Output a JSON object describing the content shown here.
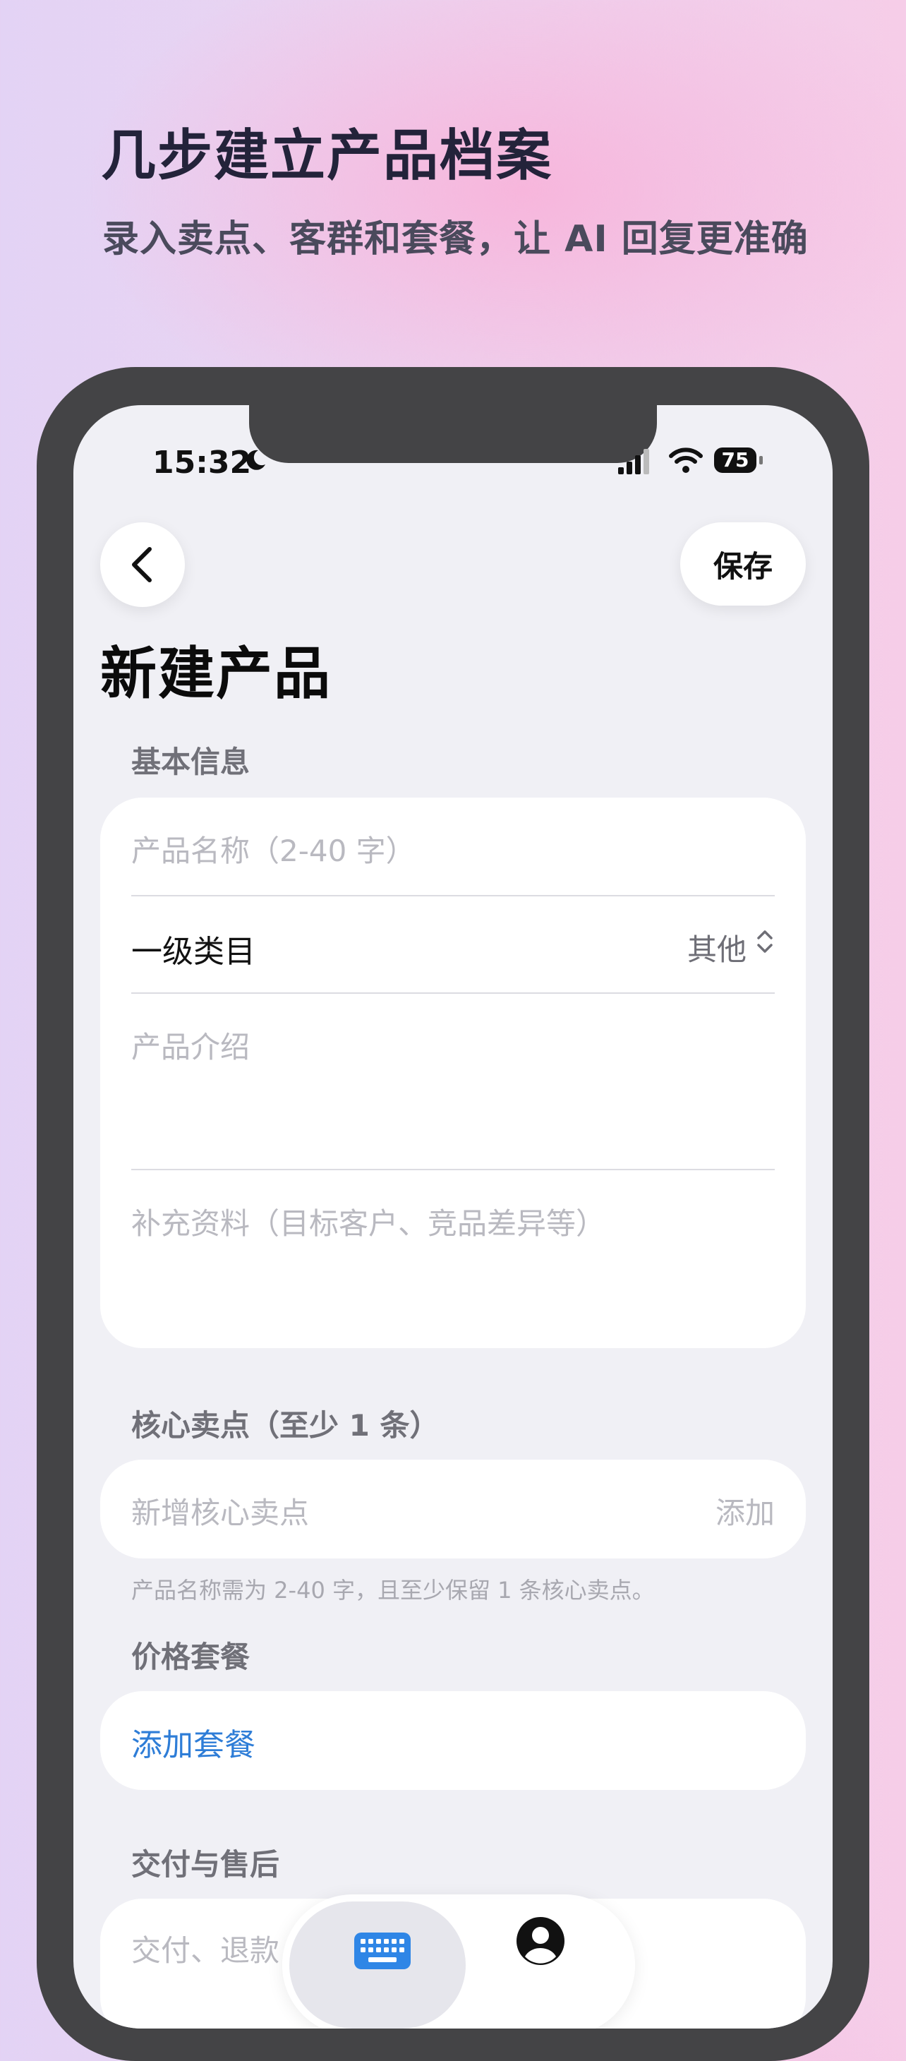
{
  "hero": {
    "title": "几步建立产品档案",
    "subtitle": "录入卖点、客群和套餐，让 AI 回复更准确"
  },
  "status_bar": {
    "time": "15:32",
    "battery": "75",
    "icons": [
      "moon-icon",
      "signal-icon",
      "wifi-icon",
      "battery-icon"
    ]
  },
  "nav": {
    "back_icon": "chevron-left-icon",
    "save_label": "保存"
  },
  "page_title": "新建产品",
  "basic_info": {
    "section_label": "基本信息",
    "name_placeholder": "产品名称（2-40 字）",
    "category_label": "一级类目",
    "category_value": "其他",
    "intro_placeholder": "产品介绍",
    "extra_placeholder": "补充资料（目标客户、竞品差异等）"
  },
  "selling_points": {
    "section_label": "核心卖点（至少 1 条）",
    "input_placeholder": "新增核心卖点",
    "add_label": "添加",
    "hint": "产品名称需为 2-40 字，且至少保留 1 条核心卖点。"
  },
  "pricing": {
    "section_label": "价格套餐",
    "add_package_label": "添加套餐"
  },
  "delivery": {
    "section_label": "交付与售后",
    "input_placeholder": "交付、退款"
  },
  "bottom_bar": {
    "items": [
      "keyboard-icon",
      "person-icon"
    ]
  },
  "colors": {
    "accent_link": "#2e7dd7",
    "phone_frame": "#444446",
    "screen_bg": "#f0f0f5"
  }
}
